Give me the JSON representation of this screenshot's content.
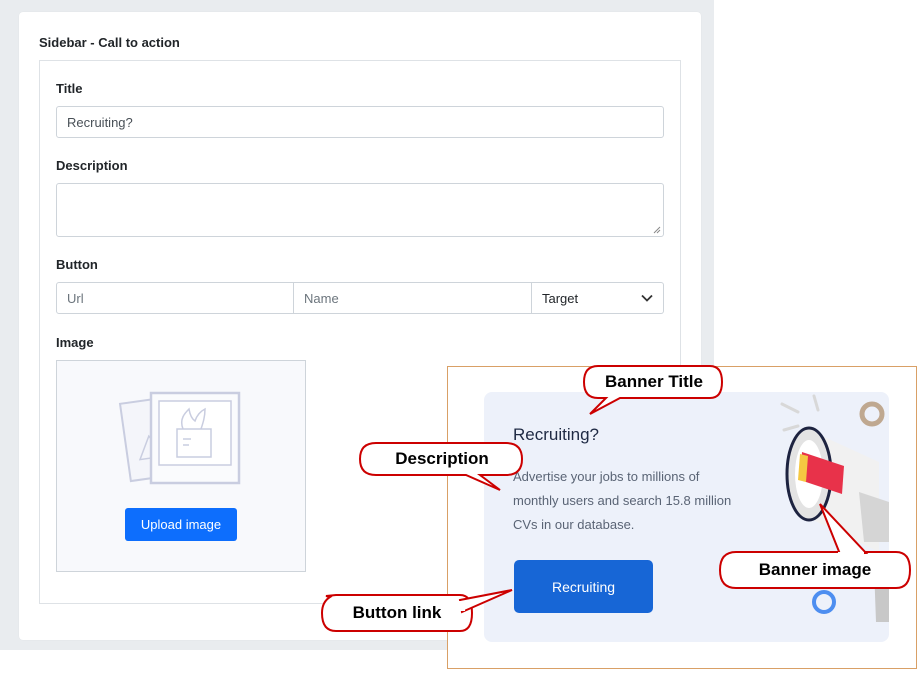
{
  "form": {
    "section_title": "Sidebar - Call to action",
    "title_label": "Title",
    "title_value": "Recruiting?",
    "description_label": "Description",
    "description_value": "",
    "button_label": "Button",
    "url_placeholder": "Url",
    "name_placeholder": "Name",
    "target_selected": "Target",
    "image_label": "Image",
    "upload_button": "Upload image"
  },
  "banner": {
    "title": "Recruiting?",
    "description": "Advertise your jobs to millions of monthly users and search 15.8 million CVs in our database.",
    "button_label": "Recruiting"
  },
  "callouts": {
    "banner_title": "Banner Title",
    "description": "Description",
    "button_link": "Button link",
    "banner_image": "Banner image"
  },
  "colors": {
    "primary_button": "#0d6efd",
    "banner_button": "#1766d6",
    "banner_bg": "#edf1fa",
    "callout_border": "#cc0000"
  },
  "icons": {
    "image_placeholder": "photos-placeholder-icon",
    "select_caret": "chevron-down-icon",
    "banner_art": "megaphone-illustration"
  }
}
